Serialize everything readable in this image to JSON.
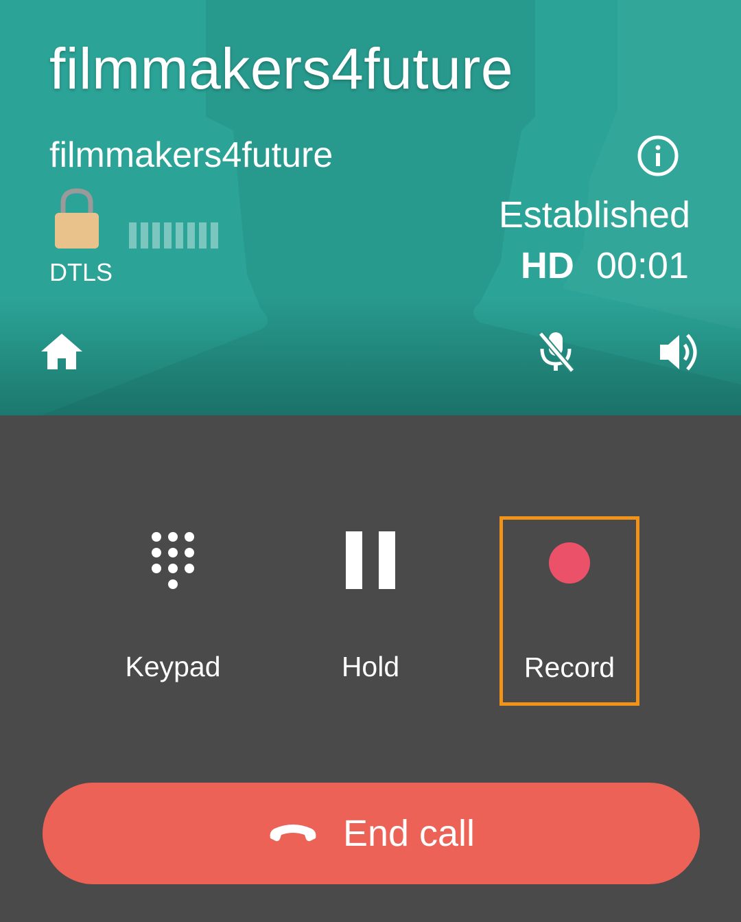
{
  "call": {
    "title": "filmmakers4future",
    "subtitle": "filmmakers4future",
    "security_label": "DTLS",
    "status": "Established",
    "quality": "HD",
    "duration": "00:01"
  },
  "icons": {
    "info": "info-icon",
    "lock": "lock-icon",
    "signal": "signal-strength-icon",
    "home": "home-icon",
    "mute": "mic-off-icon",
    "speaker": "speaker-icon",
    "keypad": "dialpad-icon",
    "hold": "pause-icon",
    "record": "record-icon",
    "end_call": "call-end-icon"
  },
  "actions": {
    "keypad_label": "Keypad",
    "hold_label": "Hold",
    "record_label": "Record",
    "end_call_label": "End call"
  },
  "colors": {
    "header_bg": "#2ba396",
    "body_bg": "#4a4a4a",
    "record_dot": "#eb5168",
    "record_highlight": "#f09318",
    "end_call_bg": "#ec6257",
    "lock": "#e8c28a"
  }
}
